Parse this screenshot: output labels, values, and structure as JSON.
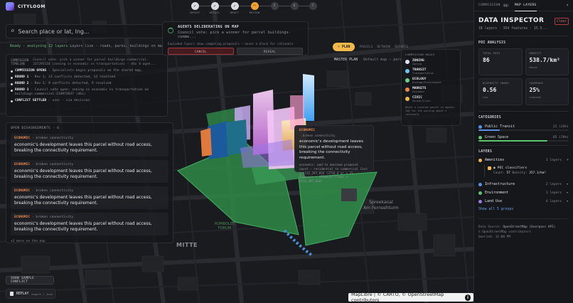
{
  "app": {
    "name": "CITYLOOM"
  },
  "stepper": [
    {
      "label": "SURVEY",
      "state": "done"
    },
    {
      "label": "DETAIL",
      "state": "done"
    },
    {
      "label": "DRAFT",
      "state": "done"
    },
    {
      "label": "REVIEW",
      "state": "active"
    },
    {
      "label": "",
      "state": "todo",
      "num": "5"
    },
    {
      "label": "",
      "state": "todo",
      "num": "6"
    },
    {
      "label": "",
      "state": "todo",
      "num": "7"
    }
  ],
  "search": {
    "placeholder": "Search place or lat, lng..."
  },
  "hint": {
    "status": "Ready - analyzing 12 layers",
    "text": "Layers live - roads, parks, buildings on map"
  },
  "timeline": {
    "title": "COMMISSION TIMELINE",
    "desc": "Council vote: pick a winner for parcel buildings-commercial-237295118 (zoning vs economic vs transportation) - 46s 8 agen...",
    "rows": [
      {
        "strong": "COMMISSION OPENS",
        "text": " - Specialists begin proposals on the shared map."
      },
      {
        "strong": "ROUND 1",
        "text": " - Rev 1; 13 conflicts detected, 12 resolved"
      },
      {
        "strong": "ROUND 2",
        "text": " - Rev 2; 9 conflicts detected, 9 resolved"
      },
      {
        "strong": "ROUND 3",
        "text": " - Council vote open: zoning vs economic vs transportation on buildings-commercial-234972037 (46s)"
      },
      {
        "strong": "CONFLICT SETTLED",
        "text": " - user - via decision"
      }
    ]
  },
  "conflicts": {
    "title": "OPEN DISAGREEMENTS · 6",
    "items": [
      {
        "tag": "ECONOMIC",
        "kind": "· broken connectivity",
        "msg": "economic's development leaves this parcel without road access, breaking the connectivity requirement."
      },
      {
        "tag": "ECONOMIC",
        "kind": "· broken connectivity",
        "msg": "economic's development leaves this parcel without road access, breaking the connectivity requirement."
      },
      {
        "tag": "ECONOMIC",
        "kind": "· broken connectivity",
        "msg": "economic's development leaves this parcel without road access, breaking the connectivity requirement."
      },
      {
        "tag": "ECONOMIC",
        "kind": "· broken connectivity",
        "msg": "economic's development leaves this parcel without road access, breaking the connectivity requirement."
      }
    ],
    "more": "+2 more on the map"
  },
  "buttons": {
    "sample": "SHOW SAMPLE CONFLICT",
    "replay": "REPLAY",
    "replay_sub": "export / json"
  },
  "deliberation": {
    "title": "AGENTS DELIBERATING ON MAP",
    "vote": "Council vote: pick a winner for parcel buildings-comme...",
    "sub": "Exploded layers show competing proposals — hover a block for rationale",
    "cancel": "CANCEL",
    "reveal": "REVEAL"
  },
  "plan": {
    "pill": "PLAN",
    "tabs": [
      "PARCELS",
      "NETWORK",
      "REPORTS"
    ],
    "master": "MASTER PLAN",
    "master_desc": "Default map — parcels, blocks..."
  },
  "roles": {
    "title": "COMMISSION ROLES",
    "items": [
      {
        "name": "ZONING",
        "sub": "Zoning",
        "color": "#e8e1f5"
      },
      {
        "name": "TRANSIT",
        "sub": "Transportation",
        "color": "#6fc0ff"
      },
      {
        "name": "ECOLOGY",
        "sub": "Ecology/Environment",
        "color": "#6fd38a"
      },
      {
        "name": "MARKETS",
        "sub": "Economic",
        "color": "#e8894b"
      },
      {
        "name": "CIVIC",
        "sub": "Social/Civic",
        "color": "#f1b84a"
      }
    ],
    "foot": "Hover a colored parcel in Agents tab for the winning agent's rationale"
  },
  "tooltip": {
    "title": "ECONOMIC",
    "sub": "· broken connectivity",
    "msg": "economic's development leaves this parcel without road access, breaking the connectivity requirement.",
    "calc": "economic: pad to maximum proposal count — residential to commercial Cost ≈ $132,287,816 (2756.0 m² × 15 floor(s) × $3200/m²/floor ≈ $132,287,816)"
  },
  "map": {
    "labels": {
      "mitte": "MITTE",
      "forum": "HUMBOLDT FORUM",
      "pub1": "Spreekanal",
      "pub2": "Am Fernsehturm"
    },
    "attribution": "MapLibre | © CARTO, © OpenStreetMap contributors"
  },
  "inspector": {
    "tabs": [
      {
        "label": "COMMISSION",
        "count": "24"
      },
      {
        "label": "MAP LAYERS",
        "count": ""
      }
    ],
    "title": "DATA INSPECTOR",
    "subtitle": "18 layers · 354 features · 15.5...",
    "clear": "Clear",
    "poi_title": "POI ANALYSIS",
    "stats": [
      {
        "k": "TOTAL POIS",
        "v": "86",
        "q": ""
      },
      {
        "k": "DENSITY",
        "v": "538.7/km²",
        "q": "Dense"
      },
      {
        "k": "DIVERSITY INDEX",
        "v": "0.56",
        "q": "Low"
      },
      {
        "k": "COVERAGE",
        "v": "25%",
        "q": "Limited"
      }
    ],
    "categories_title": "CATEGORIES",
    "categories": [
      {
        "name": "Public Transit",
        "count": "21 (24%)",
        "color": "#5a8fe8",
        "pct": 24
      },
      {
        "name": "Green Space",
        "count": "65 (76%)",
        "color": "#5ec46e",
        "pct": 76
      }
    ],
    "layers_title": "LAYERS",
    "layers": [
      {
        "name": "Amenities",
        "count": "1 layers",
        "color": "#f1b84a",
        "expanded": true
      },
      {
        "name": "Infrastructure",
        "count": "2 layers",
        "color": "#5a8fe8"
      },
      {
        "name": "Environment",
        "count": "1 layers",
        "color": "#5ec46e"
      },
      {
        "name": "Land Use",
        "count": "4 layers",
        "color": "#9a7ae8"
      }
    ],
    "sublayer": {
      "name": "POI classifiers",
      "count_label": "Count:",
      "count": "57",
      "density_label": "Density:",
      "density": "357.1/km²"
    },
    "show_all": "Show all 5 groups",
    "source": {
      "label": "Data Source:",
      "value": "OpenStreetMap (Overpass API)",
      "copy": "© OpenStreetMap contributors",
      "queried": "Queried: 11:00 PM"
    }
  }
}
